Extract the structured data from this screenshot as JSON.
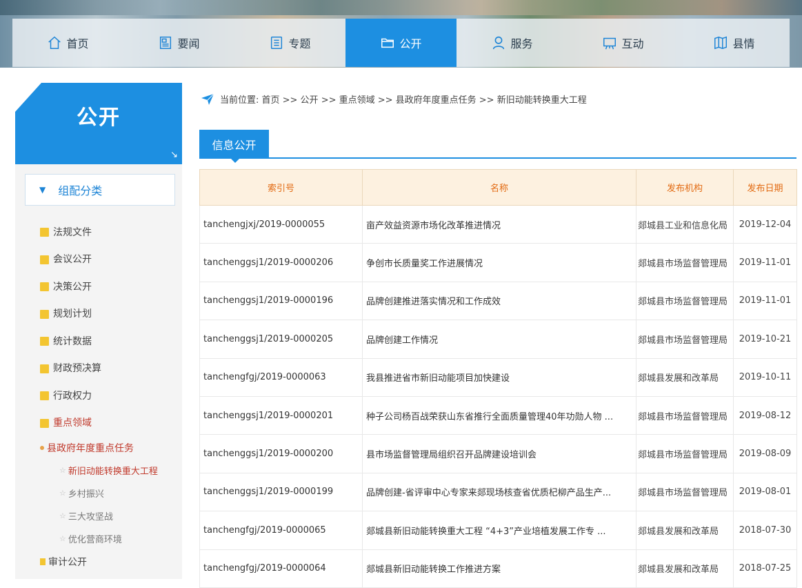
{
  "nav": {
    "items": [
      {
        "label": "首页",
        "icon": "home-icon"
      },
      {
        "label": "要闻",
        "icon": "news-icon"
      },
      {
        "label": "专题",
        "icon": "document-icon"
      },
      {
        "label": "公开",
        "icon": "folder-icon",
        "active": true
      },
      {
        "label": "服务",
        "icon": "user-icon"
      },
      {
        "label": "互动",
        "icon": "board-icon"
      },
      {
        "label": "县情",
        "icon": "map-icon"
      }
    ]
  },
  "sidebar": {
    "title": "公开",
    "category_label": "组配分类",
    "items": [
      {
        "label": "法规文件"
      },
      {
        "label": "会议公开"
      },
      {
        "label": "决策公开"
      },
      {
        "label": "规划计划"
      },
      {
        "label": "统计数据"
      },
      {
        "label": "财政预决算"
      },
      {
        "label": "行政权力"
      },
      {
        "label": "重点领域",
        "open": true
      }
    ],
    "subitems": [
      {
        "label": "县政府年度重点任务"
      },
      {
        "label": "新旧动能转换重大工程"
      },
      {
        "label": "乡村振兴"
      },
      {
        "label": "三大攻坚战"
      },
      {
        "label": "优化营商环境"
      },
      {
        "label": "审计公开"
      }
    ]
  },
  "breadcrumb": {
    "text": "当前位置: 首页 >> 公开 >> 重点领域 >> 县政府年度重点任务 >> 新旧动能转换重大工程"
  },
  "tab": {
    "label": "信息公开"
  },
  "table": {
    "headers": [
      "索引号",
      "名称",
      "发布机构",
      "发布日期"
    ],
    "rows": [
      [
        "tanchengjxj/2019-0000055",
        "亩产效益资源市场化改革推进情况",
        "郯城县工业和信息化局",
        "2019-12-04"
      ],
      [
        "tanchenggsj1/2019-0000206",
        "争创市长质量奖工作进展情况",
        "郯城县市场监督管理局",
        "2019-11-01"
      ],
      [
        "tanchenggsj1/2019-0000196",
        "品牌创建推进落实情况和工作成效",
        "郯城县市场监督管理局",
        "2019-11-01"
      ],
      [
        "tanchenggsj1/2019-0000205",
        "品牌创建工作情况",
        "郯城县市场监督管理局",
        "2019-10-21"
      ],
      [
        "tanchengfgj/2019-0000063",
        "我县推进省市新旧动能项目加快建设",
        "郯城县发展和改革局",
        "2019-10-11"
      ],
      [
        "tanchenggsj1/2019-0000201",
        "种子公司杨百战荣获山东省推行全面质量管理40年功勋人物 ...",
        "郯城县市场监督管理局",
        "2019-08-12"
      ],
      [
        "tanchenggsj1/2019-0000200",
        "县市场监督管理局组织召开品牌建设培训会",
        "郯城县市场监督管理局",
        "2019-08-09"
      ],
      [
        "tanchenggsj1/2019-0000199",
        "品牌创建-省评审中心专家来郯现场核查省优质杞柳产品生产...",
        "郯城县市场监督管理局",
        "2019-08-01"
      ],
      [
        "tanchengfgj/2019-0000065",
        "郯城县新旧动能转换重大工程 “4+3”产业培植发展工作专 ...",
        "郯城县发展和改革局",
        "2018-07-30"
      ],
      [
        "tanchengfgj/2019-0000064",
        "郯城县新旧动能转换工作推进方案",
        "郯城县发展和改革局",
        "2018-07-25"
      ]
    ]
  },
  "colors": {
    "accent": "#1d8fe1",
    "header_text": "#e26a12",
    "header_bg": "#fdf1e0",
    "active_menu": "#c0392b"
  }
}
